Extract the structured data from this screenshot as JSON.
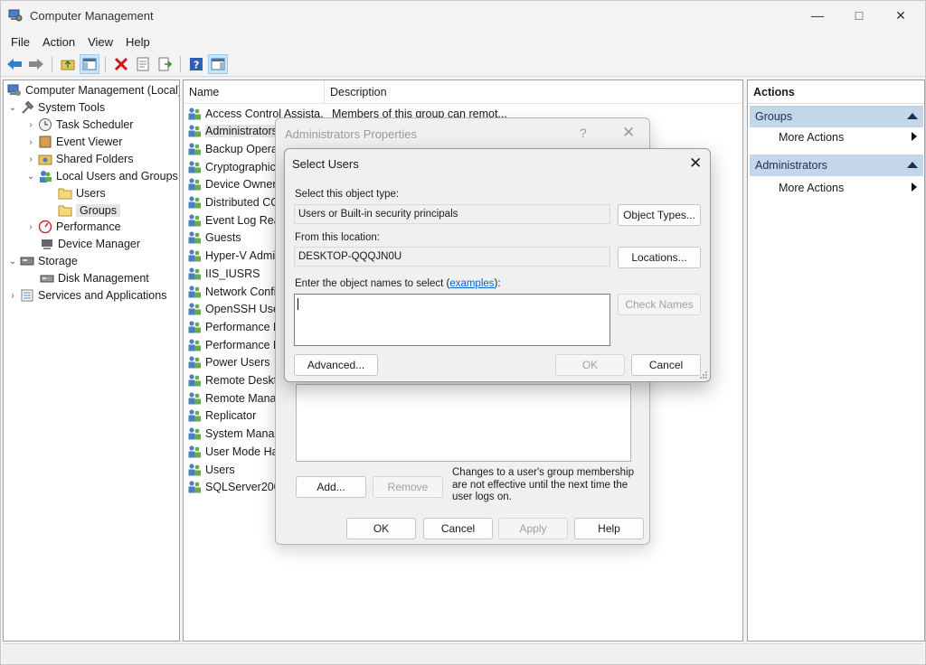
{
  "window": {
    "title": "Computer Management"
  },
  "menu": [
    "File",
    "Action",
    "View",
    "Help"
  ],
  "tree": {
    "root": "Computer Management (Local)",
    "system_tools": "System Tools",
    "task_scheduler": "Task Scheduler",
    "event_viewer": "Event Viewer",
    "shared_folders": "Shared Folders",
    "local_users_groups": "Local Users and Groups",
    "users": "Users",
    "groups": "Groups",
    "performance": "Performance",
    "device_manager": "Device Manager",
    "storage": "Storage",
    "disk_management": "Disk Management",
    "services_apps": "Services and Applications"
  },
  "list": {
    "columns": [
      "Name",
      "Description"
    ],
    "rows": [
      {
        "name": "Access Control Assista...",
        "desc": "Members of this group can remot..."
      },
      {
        "name": "Administrators",
        "desc": ""
      },
      {
        "name": "Backup Operat",
        "desc": ""
      },
      {
        "name": "Cryptographic",
        "desc": ""
      },
      {
        "name": "Device Owners",
        "desc": ""
      },
      {
        "name": "Distributed CO",
        "desc": ""
      },
      {
        "name": "Event Log Read",
        "desc": ""
      },
      {
        "name": "Guests",
        "desc": ""
      },
      {
        "name": "Hyper-V Admin",
        "desc": ""
      },
      {
        "name": "IIS_IUSRS",
        "desc": ""
      },
      {
        "name": "Network Confi",
        "desc": ""
      },
      {
        "name": "OpenSSH Users",
        "desc": ""
      },
      {
        "name": "Performance Lo",
        "desc": ""
      },
      {
        "name": "Performance M",
        "desc": ""
      },
      {
        "name": "Power Users",
        "desc": ""
      },
      {
        "name": "Remote Deskto",
        "desc": ""
      },
      {
        "name": "Remote Manag",
        "desc": ""
      },
      {
        "name": "Replicator",
        "desc": ""
      },
      {
        "name": "System Manag",
        "desc": ""
      },
      {
        "name": "User Mode Har",
        "desc": ""
      },
      {
        "name": "Users",
        "desc": ""
      },
      {
        "name": "SQLServer2005",
        "desc": ""
      }
    ]
  },
  "actions": {
    "title": "Actions",
    "section1": "Groups",
    "section1_item": "More Actions",
    "section2": "Administrators",
    "section2_item": "More Actions"
  },
  "props_dialog": {
    "title": "Administrators Properties",
    "help": "?",
    "add": "Add...",
    "remove": "Remove",
    "note": "Changes to a user's group membership are not effective until the next time the user logs on.",
    "ok": "OK",
    "cancel": "Cancel",
    "apply": "Apply",
    "help_btn": "Help"
  },
  "select_dialog": {
    "title": "Select Users",
    "object_type_label": "Select this object type:",
    "object_type_value": "Users or Built-in security principals",
    "object_types_btn": "Object Types...",
    "location_label": "From this location:",
    "location_value": "DESKTOP-QQQJN0U",
    "locations_btn": "Locations...",
    "names_label_pre": "Enter the object names to select (",
    "names_label_link": "examples",
    "names_label_post": "):",
    "check_names_btn": "Check Names",
    "advanced_btn": "Advanced...",
    "ok_btn": "OK",
    "cancel_btn": "Cancel"
  }
}
